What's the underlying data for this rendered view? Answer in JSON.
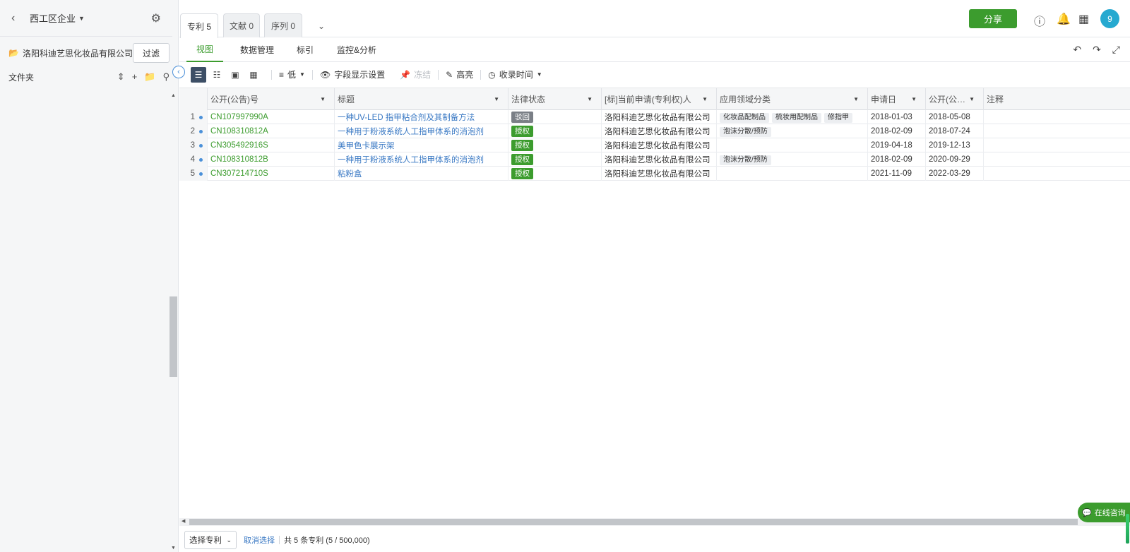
{
  "sidebar": {
    "workspace_title": "西工区企业",
    "company_name": "洛阳科迪艺思化妆品有限公司",
    "filter_label": "过滤",
    "folder_label": "文件夹"
  },
  "tabs": [
    {
      "label": "专利 5",
      "active": true
    },
    {
      "label": "文献 0",
      "active": false
    },
    {
      "label": "序列 0",
      "active": false
    }
  ],
  "header": {
    "share_label": "分享",
    "avatar_text": "9"
  },
  "subnav": [
    {
      "label": "视图",
      "active": true
    },
    {
      "label": "数据管理",
      "active": false
    },
    {
      "label": "标引",
      "active": false
    },
    {
      "label": "监控&分析",
      "active": false
    }
  ],
  "toolbar": {
    "density_label": "低",
    "fields_label": "字段显示设置",
    "freeze_label": "冻结",
    "highlight_label": "高亮",
    "sort_label": "收录时间"
  },
  "table": {
    "columns": [
      "公开(公告)号",
      "标题",
      "法律状态",
      "[标]当前申请(专利权)人",
      "应用领域分类",
      "申请日",
      "公开(公…",
      "注释"
    ],
    "rows": [
      {
        "idx": "1",
        "pn": "CN107997990A",
        "title": "一种UV-LED 指甲粘合剂及其制备方法",
        "status": "驳回",
        "status_color": "#7a7f86",
        "applicant": "洛阳科迪艺思化妆品有限公司",
        "tags": [
          "化妆品配制品",
          "梳妆用配制品",
          "修指甲"
        ],
        "app_date": "2018-01-03",
        "pub_date": "2018-05-08"
      },
      {
        "idx": "2",
        "pn": "CN108310812A",
        "title": "一种用于粉液系统人工指甲体系的消泡剂",
        "status": "授权",
        "status_color": "#3c9c2e",
        "applicant": "洛阳科迪艺思化妆品有限公司",
        "tags": [
          "泡沫分散/预防"
        ],
        "app_date": "2018-02-09",
        "pub_date": "2018-07-24"
      },
      {
        "idx": "3",
        "pn": "CN305492916S",
        "title": "美甲色卡展示架",
        "status": "授权",
        "status_color": "#3c9c2e",
        "applicant": "洛阳科迪艺思化妆品有限公司",
        "tags": [],
        "app_date": "2019-04-18",
        "pub_date": "2019-12-13"
      },
      {
        "idx": "4",
        "pn": "CN108310812B",
        "title": "一种用于粉液系统人工指甲体系的消泡剂",
        "status": "授权",
        "status_color": "#3c9c2e",
        "applicant": "洛阳科迪艺思化妆品有限公司",
        "tags": [
          "泡沫分散/预防"
        ],
        "app_date": "2018-02-09",
        "pub_date": "2020-09-29"
      },
      {
        "idx": "5",
        "pn": "CN307214710S",
        "title": "粘粉盒",
        "status": "授权",
        "status_color": "#3c9c2e",
        "applicant": "洛阳科迪艺思化妆品有限公司",
        "tags": [],
        "app_date": "2021-11-09",
        "pub_date": "2022-03-29"
      }
    ]
  },
  "footer": {
    "select_label": "选择专利",
    "cancel_label": "取消选择",
    "count_text": "共 5 条专利 (5 / 500,000)"
  },
  "consult_label": "在线咨询"
}
